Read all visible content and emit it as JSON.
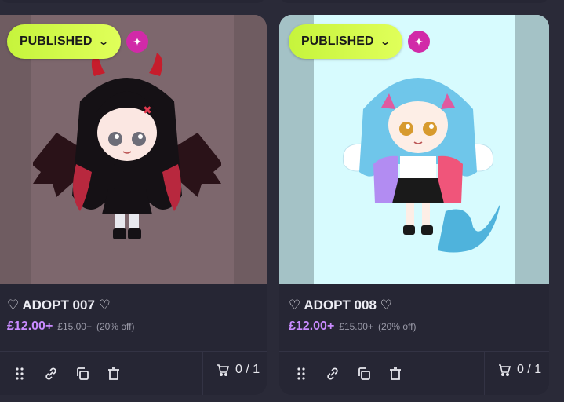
{
  "cards": [
    {
      "status_label": "PUBLISHED",
      "title": "♡ ADOPT 007 ♡",
      "price": "£12.00+",
      "original_price": "£15.00+",
      "discount": "(20% off)",
      "stock": "0 / 1",
      "theme": {
        "bg": "#7d676d",
        "panel": "#6f5c61"
      }
    },
    {
      "status_label": "PUBLISHED",
      "title": "♡ ADOPT 008 ♡",
      "price": "£12.00+",
      "original_price": "£15.00+",
      "discount": "(20% off)",
      "stock": "0 / 1",
      "theme": {
        "bg": "#d7fbfe",
        "panel": "#a4c2c6"
      }
    }
  ],
  "colors": {
    "badge": "#c6f43c",
    "sparkle": "#d12aa8",
    "price": "#c98bff",
    "card": "#262634"
  },
  "icons": [
    "chevron-down-icon",
    "sparkle-icon",
    "drag-handle-icon",
    "link-icon",
    "copy-icon",
    "trash-icon",
    "cart-icon"
  ]
}
